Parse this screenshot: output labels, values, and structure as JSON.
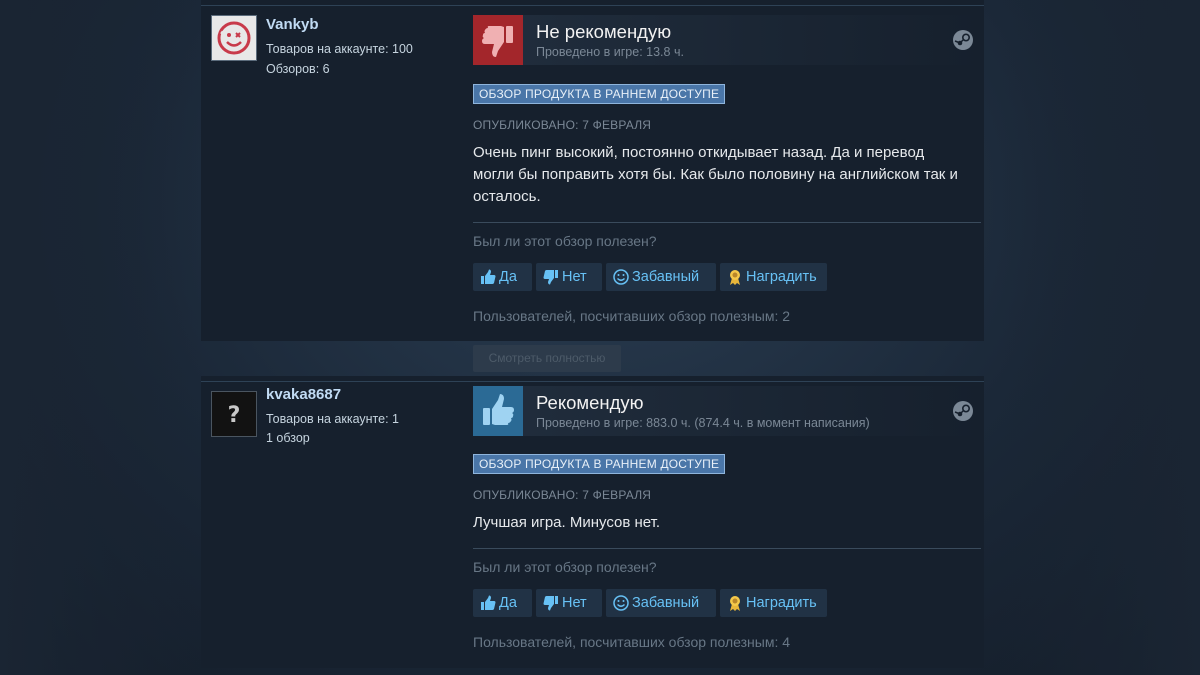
{
  "reviews": [
    {
      "username": "Vankyb",
      "products_on_account": "Товаров на аккаунте: 100",
      "reviews_count": "Обзоров: 6",
      "verdict": "Не рекомендую",
      "playtime": "Проведено в игре: 13.8 ч.",
      "badge": "ОБЗОР ПРОДУКТА В РАННЕМ ДОСТУПЕ",
      "posted": "ОПУБЛИКОВАНО: 7 ФЕВРАЛЯ",
      "text": "Очень пинг высокий, постоянно откидывает назад. Да и перевод могли бы поправить хотя бы. Как было половину на английском так и осталось.",
      "helpful_question": "Был ли этот обзор полезен?",
      "votes": {
        "yes": "Да",
        "no": "Нет",
        "funny": "Забавный",
        "award": "Наградить"
      },
      "helpful_count": "Пользователей, посчитавших обзор полезным: 2",
      "icons": {
        "avatar": "red-smiley-avatar",
        "verdict": "thumbs-down-icon",
        "platform": "steam-icon"
      },
      "verdict_color": "#a3262b"
    },
    {
      "username": "kvaka8687",
      "products_on_account": "Товаров на аккаунте: 1",
      "reviews_count": "1 обзор",
      "verdict": "Рекомендую",
      "playtime": "Проведено в игре: 883.0 ч. (874.4 ч. в момент написания)",
      "badge": "ОБЗОР ПРОДУКТА В РАННЕМ ДОСТУПЕ",
      "posted": "ОПУБЛИКОВАНО: 7 ФЕВРАЛЯ",
      "text": "Лучшая игра. Минусов нет.",
      "helpful_question": "Был ли этот обзор полезен?",
      "votes": {
        "yes": "Да",
        "no": "Нет",
        "funny": "Забавный",
        "award": "Наградить"
      },
      "helpful_count": "Пользователей, посчитавших обзор полезным: 4",
      "icons": {
        "avatar": "question-mark-avatar",
        "verdict": "thumbs-up-icon",
        "platform": "steam-icon"
      },
      "verdict_color": "#2b6a95"
    }
  ],
  "read_more": "Смотреть полностью",
  "colors": {
    "background": "#1b2838",
    "card": "#16202d",
    "link": "#67c1f5",
    "badge": "#4a76a8"
  }
}
